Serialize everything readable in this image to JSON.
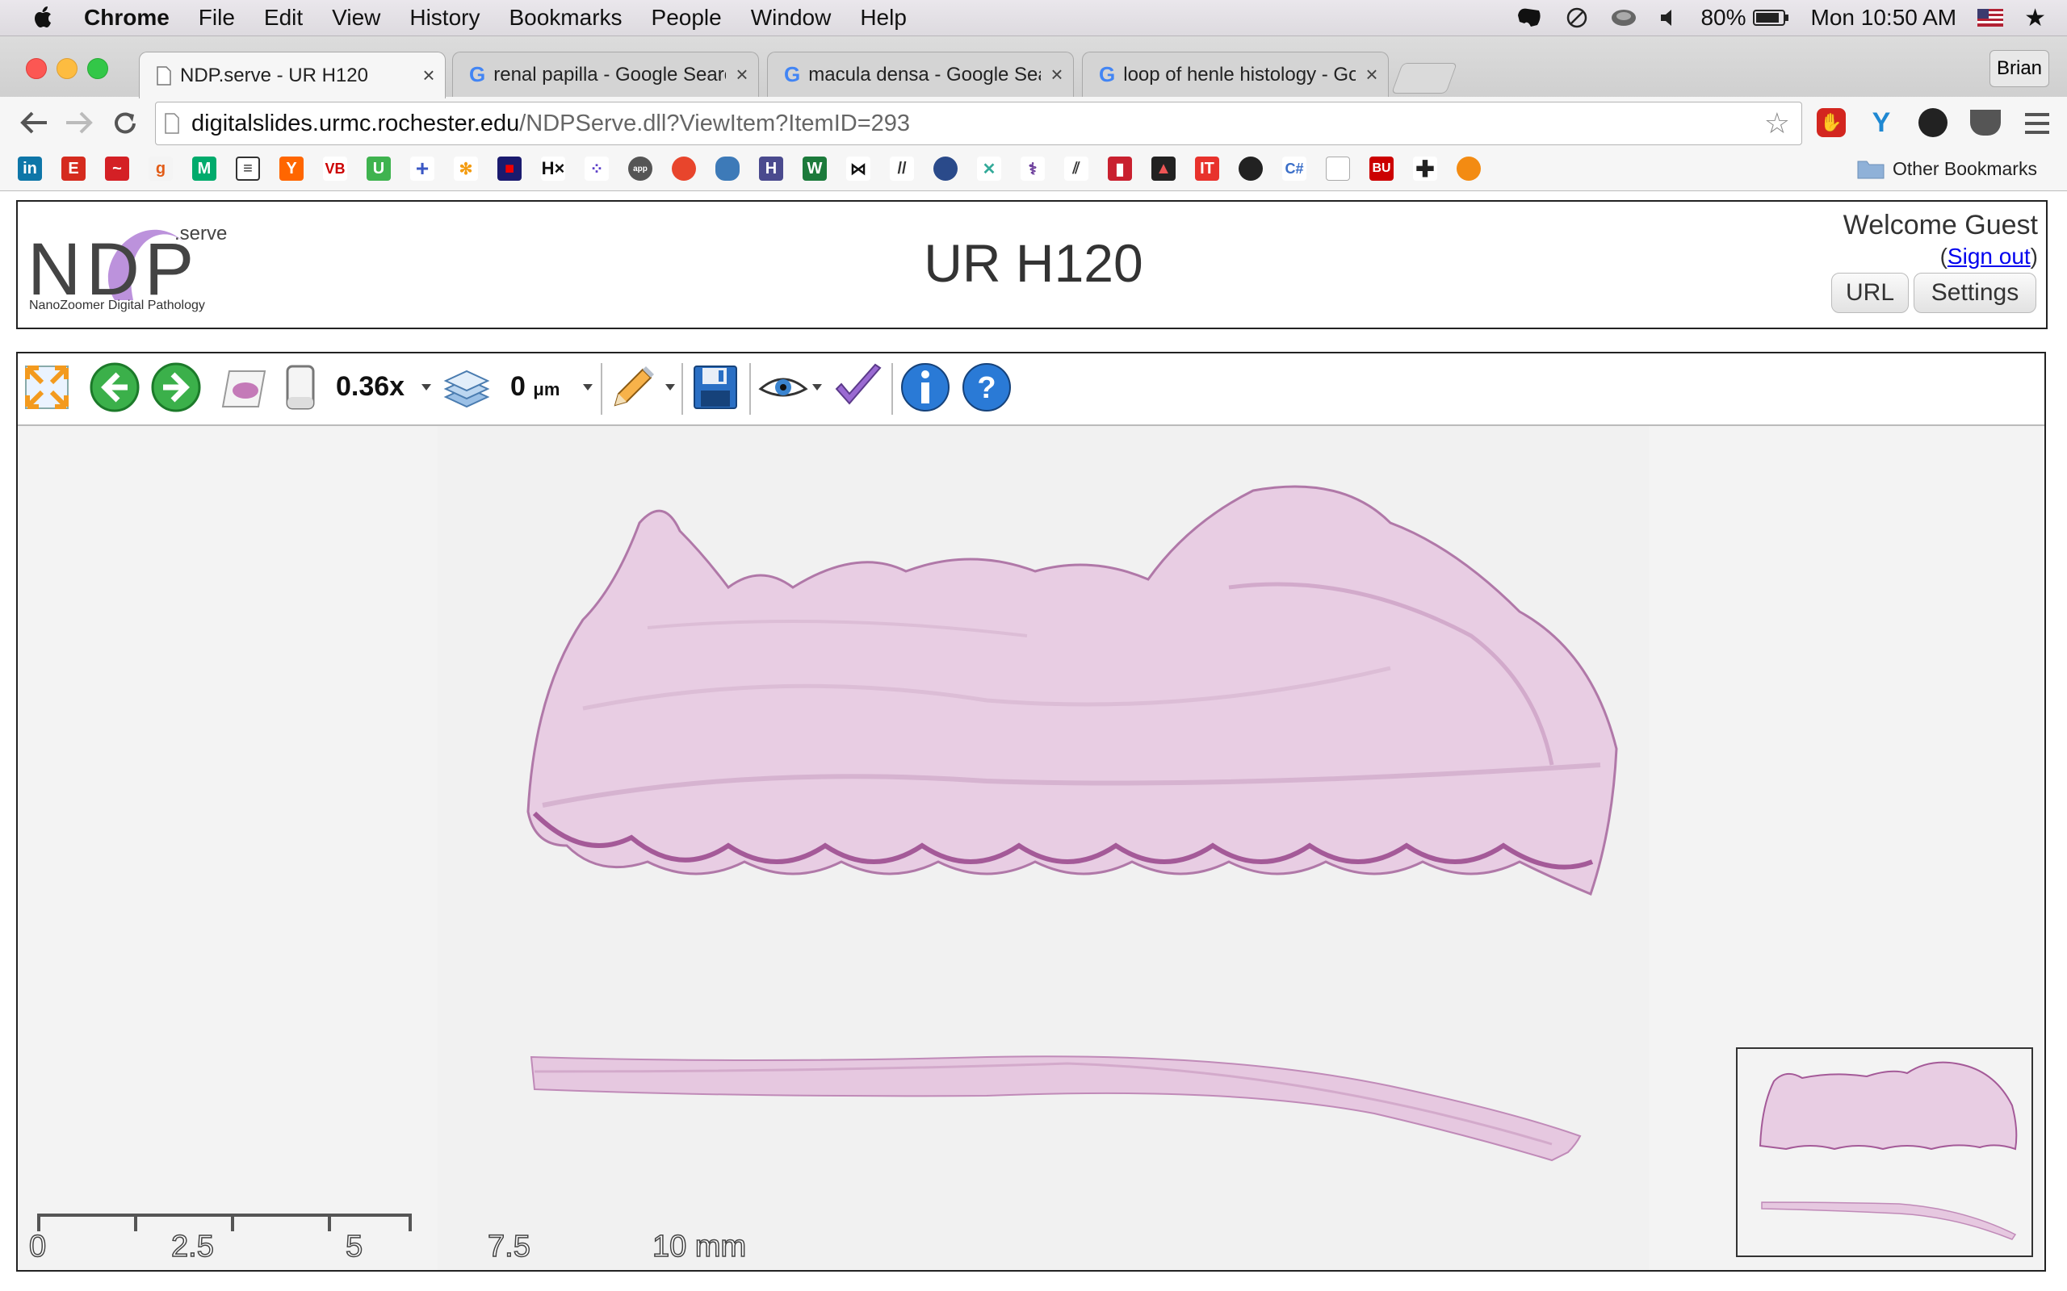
{
  "menubar": {
    "items": [
      "Chrome",
      "File",
      "Edit",
      "View",
      "History",
      "Bookmarks",
      "People",
      "Window",
      "Help"
    ],
    "battery": "80%",
    "clock": "Mon 10:50 AM"
  },
  "browser": {
    "tabs": [
      {
        "title": "NDP.serve - UR H120",
        "active": true
      },
      {
        "title": "renal papilla - Google Search",
        "active": false
      },
      {
        "title": "macula densa - Google Search",
        "active": false
      },
      {
        "title": "loop of henle histology - Google Search",
        "active": false
      }
    ],
    "profile": "Brian",
    "url_host": "digitalslides.urmc.rochester.edu",
    "url_path": "/NDPServe.dll?ViewItem?ItemID=293",
    "other_bookmarks": "Other Bookmarks"
  },
  "ndp": {
    "logo_text": "NDP",
    "logo_sup": ".serve",
    "logo_sub": "NanoZoomer Digital Pathology",
    "title": "UR H120",
    "welcome": "Welcome Guest",
    "sign_out_prefix": "(",
    "sign_out": "Sign out",
    "sign_out_suffix": ")",
    "url_button": "URL",
    "settings_button": "Settings",
    "zoom": "0.36x",
    "focus_value": "0",
    "focus_unit": "μm",
    "scale_ticks": [
      "0",
      "2.5",
      "5",
      "7.5",
      "10 mm"
    ]
  },
  "colors": {
    "tissue": "#e8cde3",
    "tissue_edge": "#b078a8",
    "accent_link": "#0000ee"
  }
}
